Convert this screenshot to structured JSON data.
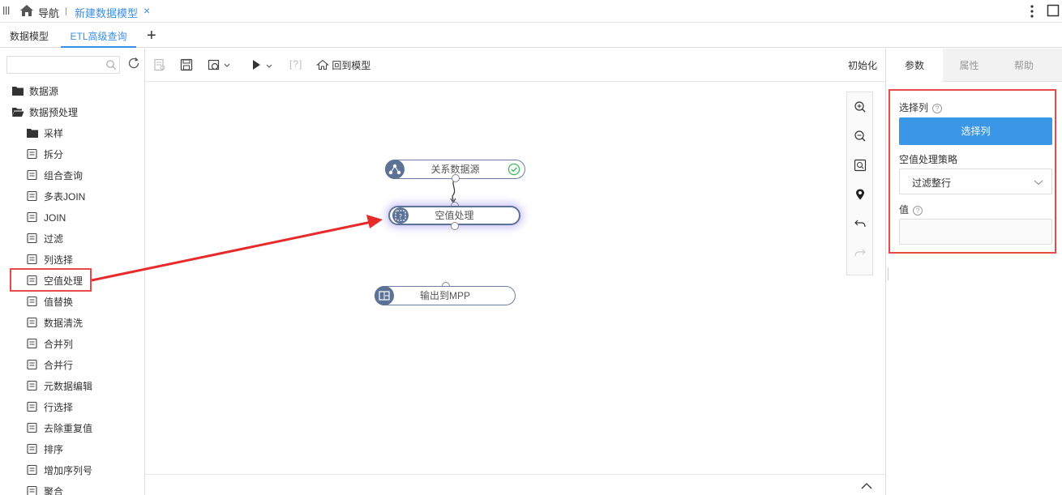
{
  "topbar": {
    "nav_label": "导航",
    "active_tab": "新建数据模型",
    "close_symbol": "×"
  },
  "subtabs": {
    "items": [
      "数据模型",
      "ETL高级查询"
    ],
    "add_symbol": "+"
  },
  "left_panel": {
    "search": {
      "value": "",
      "placeholder": ""
    },
    "tree": [
      {
        "label": "数据源",
        "icon": "folder-icon"
      },
      {
        "label": "数据预处理",
        "icon": "folder-open-icon"
      },
      {
        "label": "采样",
        "icon": "folder-icon"
      },
      {
        "label": "拆分",
        "icon": "split-icon"
      },
      {
        "label": "组合查询",
        "icon": "combine-query-icon"
      },
      {
        "label": "多表JOIN",
        "icon": "multi-join-icon"
      },
      {
        "label": "JOIN",
        "icon": "join-icon"
      },
      {
        "label": "过滤",
        "icon": "filter-icon"
      },
      {
        "label": "列选择",
        "icon": "column-select-icon"
      },
      {
        "label": "空值处理",
        "icon": "null-handling-icon"
      },
      {
        "label": "值替换",
        "icon": "value-replace-icon"
      },
      {
        "label": "数据清洗",
        "icon": "data-clean-icon"
      },
      {
        "label": "合并列",
        "icon": "merge-column-icon"
      },
      {
        "label": "合并行",
        "icon": "merge-row-icon"
      },
      {
        "label": "元数据编辑",
        "icon": "metadata-edit-icon"
      },
      {
        "label": "行选择",
        "icon": "row-select-icon"
      },
      {
        "label": "去除重复值",
        "icon": "dedupe-icon"
      },
      {
        "label": "排序",
        "icon": "sort-icon"
      },
      {
        "label": "增加序列号",
        "icon": "serial-number-icon"
      },
      {
        "label": "聚合",
        "icon": "aggregate-icon"
      }
    ]
  },
  "toolbar": {
    "bracket_help": "[?]",
    "back_to_model": "回到模型",
    "init": "初始化"
  },
  "nodes": {
    "source": "关系数据源",
    "null_handle": "空值处理",
    "output": "输出到MPP"
  },
  "right_panel": {
    "tabs": [
      "参数",
      "属性",
      "帮助"
    ],
    "select_column_label": "选择列",
    "select_column_button": "选择列",
    "null_strategy_label": "空值处理策略",
    "null_strategy_value": "过滤整行",
    "value_label": "值",
    "value_input": "",
    "help_symbol": "?"
  },
  "colors": {
    "accent": "#3a8ee6",
    "button": "#3a97e8",
    "highlight_red": "#e84a4a",
    "node_icon": "#5d7396"
  }
}
